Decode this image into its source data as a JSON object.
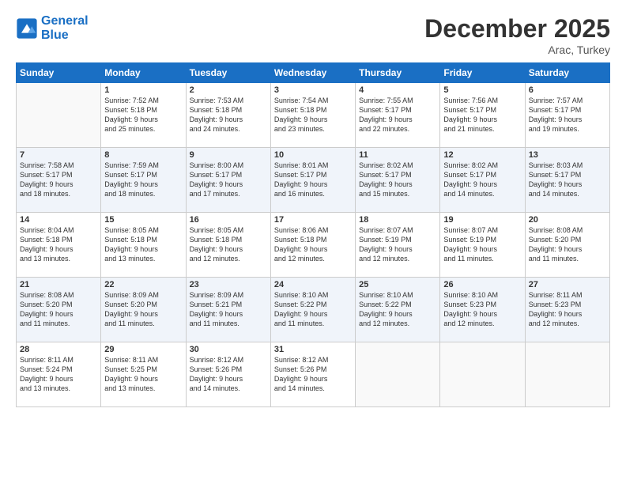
{
  "logo": {
    "line1": "General",
    "line2": "Blue"
  },
  "title": "December 2025",
  "location": "Arac, Turkey",
  "days_of_week": [
    "Sunday",
    "Monday",
    "Tuesday",
    "Wednesday",
    "Thursday",
    "Friday",
    "Saturday"
  ],
  "weeks": [
    [
      {
        "day": "",
        "info": ""
      },
      {
        "day": "1",
        "info": "Sunrise: 7:52 AM\nSunset: 5:18 PM\nDaylight: 9 hours\nand 25 minutes."
      },
      {
        "day": "2",
        "info": "Sunrise: 7:53 AM\nSunset: 5:18 PM\nDaylight: 9 hours\nand 24 minutes."
      },
      {
        "day": "3",
        "info": "Sunrise: 7:54 AM\nSunset: 5:18 PM\nDaylight: 9 hours\nand 23 minutes."
      },
      {
        "day": "4",
        "info": "Sunrise: 7:55 AM\nSunset: 5:17 PM\nDaylight: 9 hours\nand 22 minutes."
      },
      {
        "day": "5",
        "info": "Sunrise: 7:56 AM\nSunset: 5:17 PM\nDaylight: 9 hours\nand 21 minutes."
      },
      {
        "day": "6",
        "info": "Sunrise: 7:57 AM\nSunset: 5:17 PM\nDaylight: 9 hours\nand 19 minutes."
      }
    ],
    [
      {
        "day": "7",
        "info": "Sunrise: 7:58 AM\nSunset: 5:17 PM\nDaylight: 9 hours\nand 18 minutes."
      },
      {
        "day": "8",
        "info": "Sunrise: 7:59 AM\nSunset: 5:17 PM\nDaylight: 9 hours\nand 18 minutes."
      },
      {
        "day": "9",
        "info": "Sunrise: 8:00 AM\nSunset: 5:17 PM\nDaylight: 9 hours\nand 17 minutes."
      },
      {
        "day": "10",
        "info": "Sunrise: 8:01 AM\nSunset: 5:17 PM\nDaylight: 9 hours\nand 16 minutes."
      },
      {
        "day": "11",
        "info": "Sunrise: 8:02 AM\nSunset: 5:17 PM\nDaylight: 9 hours\nand 15 minutes."
      },
      {
        "day": "12",
        "info": "Sunrise: 8:02 AM\nSunset: 5:17 PM\nDaylight: 9 hours\nand 14 minutes."
      },
      {
        "day": "13",
        "info": "Sunrise: 8:03 AM\nSunset: 5:17 PM\nDaylight: 9 hours\nand 14 minutes."
      }
    ],
    [
      {
        "day": "14",
        "info": "Sunrise: 8:04 AM\nSunset: 5:18 PM\nDaylight: 9 hours\nand 13 minutes."
      },
      {
        "day": "15",
        "info": "Sunrise: 8:05 AM\nSunset: 5:18 PM\nDaylight: 9 hours\nand 13 minutes."
      },
      {
        "day": "16",
        "info": "Sunrise: 8:05 AM\nSunset: 5:18 PM\nDaylight: 9 hours\nand 12 minutes."
      },
      {
        "day": "17",
        "info": "Sunrise: 8:06 AM\nSunset: 5:18 PM\nDaylight: 9 hours\nand 12 minutes."
      },
      {
        "day": "18",
        "info": "Sunrise: 8:07 AM\nSunset: 5:19 PM\nDaylight: 9 hours\nand 12 minutes."
      },
      {
        "day": "19",
        "info": "Sunrise: 8:07 AM\nSunset: 5:19 PM\nDaylight: 9 hours\nand 11 minutes."
      },
      {
        "day": "20",
        "info": "Sunrise: 8:08 AM\nSunset: 5:20 PM\nDaylight: 9 hours\nand 11 minutes."
      }
    ],
    [
      {
        "day": "21",
        "info": "Sunrise: 8:08 AM\nSunset: 5:20 PM\nDaylight: 9 hours\nand 11 minutes."
      },
      {
        "day": "22",
        "info": "Sunrise: 8:09 AM\nSunset: 5:20 PM\nDaylight: 9 hours\nand 11 minutes."
      },
      {
        "day": "23",
        "info": "Sunrise: 8:09 AM\nSunset: 5:21 PM\nDaylight: 9 hours\nand 11 minutes."
      },
      {
        "day": "24",
        "info": "Sunrise: 8:10 AM\nSunset: 5:22 PM\nDaylight: 9 hours\nand 11 minutes."
      },
      {
        "day": "25",
        "info": "Sunrise: 8:10 AM\nSunset: 5:22 PM\nDaylight: 9 hours\nand 12 minutes."
      },
      {
        "day": "26",
        "info": "Sunrise: 8:10 AM\nSunset: 5:23 PM\nDaylight: 9 hours\nand 12 minutes."
      },
      {
        "day": "27",
        "info": "Sunrise: 8:11 AM\nSunset: 5:23 PM\nDaylight: 9 hours\nand 12 minutes."
      }
    ],
    [
      {
        "day": "28",
        "info": "Sunrise: 8:11 AM\nSunset: 5:24 PM\nDaylight: 9 hours\nand 13 minutes."
      },
      {
        "day": "29",
        "info": "Sunrise: 8:11 AM\nSunset: 5:25 PM\nDaylight: 9 hours\nand 13 minutes."
      },
      {
        "day": "30",
        "info": "Sunrise: 8:12 AM\nSunset: 5:26 PM\nDaylight: 9 hours\nand 14 minutes."
      },
      {
        "day": "31",
        "info": "Sunrise: 8:12 AM\nSunset: 5:26 PM\nDaylight: 9 hours\nand 14 minutes."
      },
      {
        "day": "",
        "info": ""
      },
      {
        "day": "",
        "info": ""
      },
      {
        "day": "",
        "info": ""
      }
    ]
  ]
}
